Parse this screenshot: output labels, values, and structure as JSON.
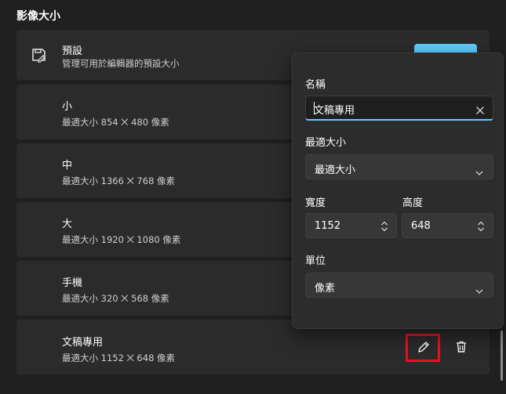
{
  "section": {
    "title": "影像大小"
  },
  "preset_card": {
    "title": "預設",
    "subtitle": "管理可用於編輯器的預設大小",
    "icon": "preset-icon",
    "accent_color": "#60cdff"
  },
  "presets": [
    {
      "title": "小",
      "subtitle": "最適大小 854 ⨉ 480 像素"
    },
    {
      "title": "中",
      "subtitle": "最適大小 1366 ⨉ 768 像素"
    },
    {
      "title": "大",
      "subtitle": "最適大小 1920 ⨉ 1080 像素"
    },
    {
      "title": "手機",
      "subtitle": "最適大小 320 ⨉ 568 像素"
    },
    {
      "title": "文稿專用",
      "subtitle": "最適大小 1152 ⨉ 648 像素"
    }
  ],
  "row_actions": {
    "edit_icon": "pencil-icon",
    "delete_icon": "trash-icon",
    "highlight_color": "#e81123"
  },
  "flyout": {
    "name_label": "名稱",
    "name_value": "文稿專用",
    "fit_label": "最適大小",
    "fit_value": "最適大小",
    "width_label": "寬度",
    "width_value": "1152",
    "height_label": "高度",
    "height_value": "648",
    "unit_label": "單位",
    "unit_value": "像素"
  }
}
